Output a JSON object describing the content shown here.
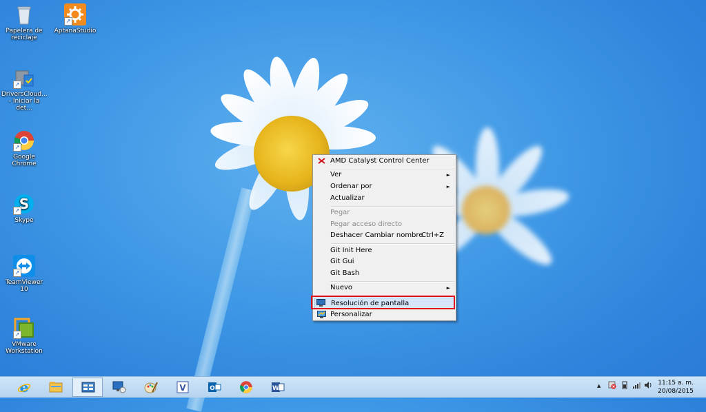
{
  "desktop": {
    "icons": [
      {
        "label": "Papelera de reciclaje",
        "icon": "recycle-bin-icon"
      },
      {
        "label": "AptanaStudio",
        "icon": "aptana-studio-icon"
      },
      {
        "label": "DriversCloud... - Iniciar la det...",
        "icon": "drivers-cloud-icon"
      },
      {
        "label": "Google Chrome",
        "icon": "chrome-icon"
      },
      {
        "label": "Skype",
        "icon": "skype-icon"
      },
      {
        "label": "TeamViewer 10",
        "icon": "teamviewer-icon"
      },
      {
        "label": "VMware Workstation",
        "icon": "vmware-icon"
      }
    ]
  },
  "context_menu": {
    "items": [
      {
        "label": "AMD Catalyst Control Center",
        "icon": "amd-catalyst-icon"
      },
      {
        "label": "Ver",
        "submenu": true
      },
      {
        "label": "Ordenar por",
        "submenu": true
      },
      {
        "label": "Actualizar"
      },
      {
        "label": "Pegar",
        "disabled": true
      },
      {
        "label": "Pegar acceso directo",
        "disabled": true
      },
      {
        "label": "Deshacer Cambiar nombre",
        "shortcut": "Ctrl+Z"
      },
      {
        "label": "Git Init Here"
      },
      {
        "label": "Git Gui"
      },
      {
        "label": "Git Bash"
      },
      {
        "label": "Nuevo",
        "submenu": true
      },
      {
        "label": "Resolución de pantalla",
        "icon": "screen-resolution-icon",
        "highlighted": true
      },
      {
        "label": "Personalizar",
        "icon": "personalize-icon"
      }
    ],
    "submenu_arrow": "►"
  },
  "taskbar": {
    "pinned": [
      {
        "name": "internet-explorer-icon"
      },
      {
        "name": "file-explorer-icon"
      },
      {
        "name": "control-panel-icon",
        "active": true
      },
      {
        "name": "remote-desktop-icon"
      },
      {
        "name": "paint-icon"
      },
      {
        "name": "visio-icon"
      },
      {
        "name": "outlook-icon"
      },
      {
        "name": "chrome-icon"
      },
      {
        "name": "word-icon"
      }
    ],
    "tray_arrow": "▲",
    "clock": {
      "time": "11:15 a. m.",
      "date": "20/08/2015"
    }
  },
  "colors": {
    "highlight_box": "#e0101e",
    "menu_bg": "#f0f0f0",
    "taskbar_bg": "#c4dcf2"
  }
}
